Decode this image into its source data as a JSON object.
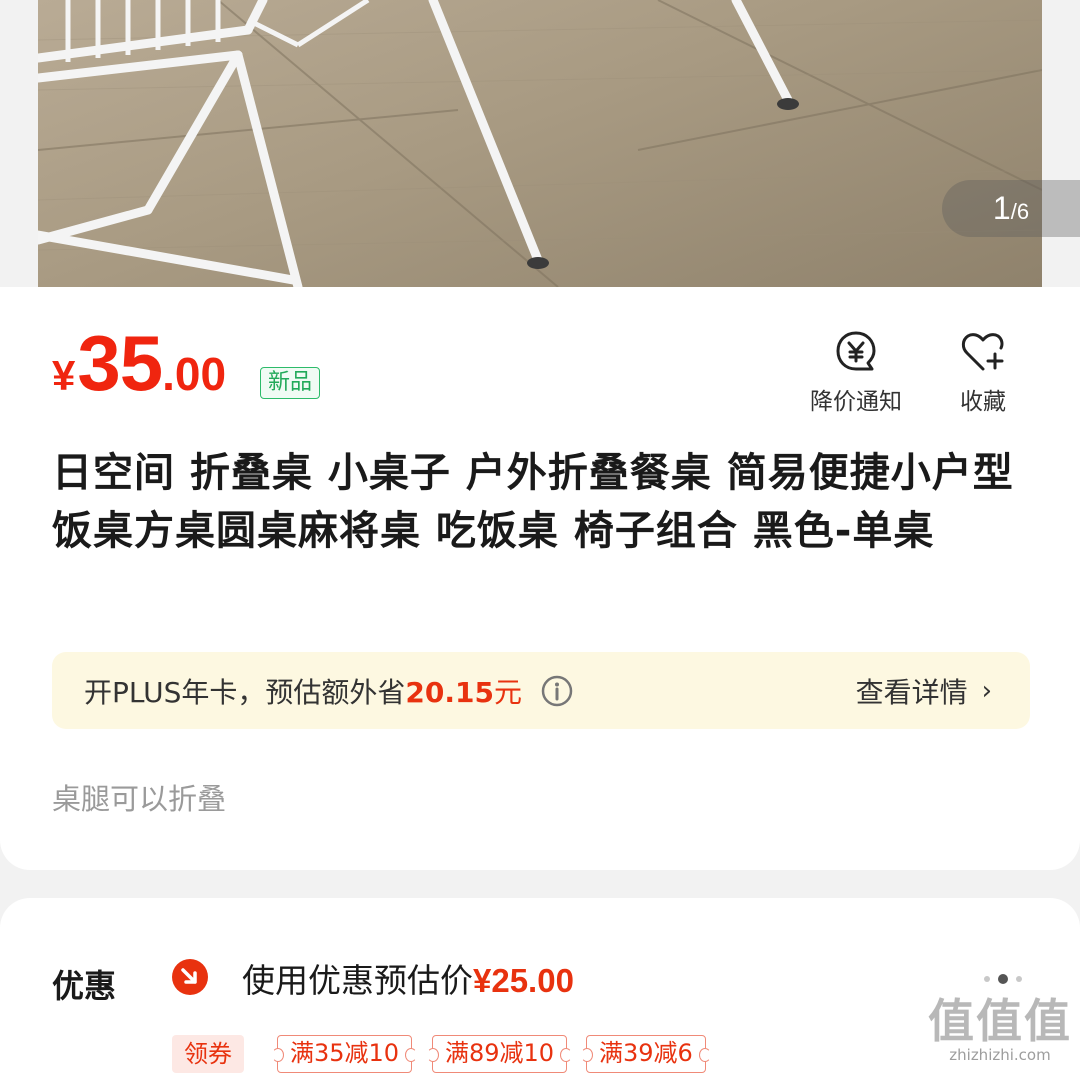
{
  "gallery": {
    "current": "1",
    "separator": "/",
    "total": "6"
  },
  "price": {
    "currency": "¥",
    "integer": "35",
    "decimal": ".00",
    "badge": "新品"
  },
  "actions": {
    "notify": {
      "label": "降价通知",
      "icon": "price-drop-bell-icon"
    },
    "favorite": {
      "label": "收藏",
      "icon": "heart-plus-icon"
    }
  },
  "product": {
    "title": "日空间 折叠桌 小桌子 户外折叠餐桌 简易便捷小户型饭桌方桌圆桌麻将桌 吃饭桌 椅子组合 黑色-单桌",
    "subtitle": "桌腿可以折叠"
  },
  "plus": {
    "text": "开PLUS年卡，预估额外省",
    "amount": "20.15",
    "unit": "元",
    "detail_label": "查看详情",
    "chevron": "›"
  },
  "promo": {
    "label": "优惠",
    "estimate_text": "使用优惠预估价",
    "estimate_price": "¥25.00",
    "coupon_tag": "领券",
    "coupons": [
      "满35减10",
      "满89减10",
      "满39减6"
    ]
  },
  "watermark": {
    "big": "值值值",
    "small": "zhizhizhi.com"
  },
  "colors": {
    "price_red": "#f0250f",
    "new_green": "#22aa5a",
    "plus_bg": "#fdf8e1"
  }
}
